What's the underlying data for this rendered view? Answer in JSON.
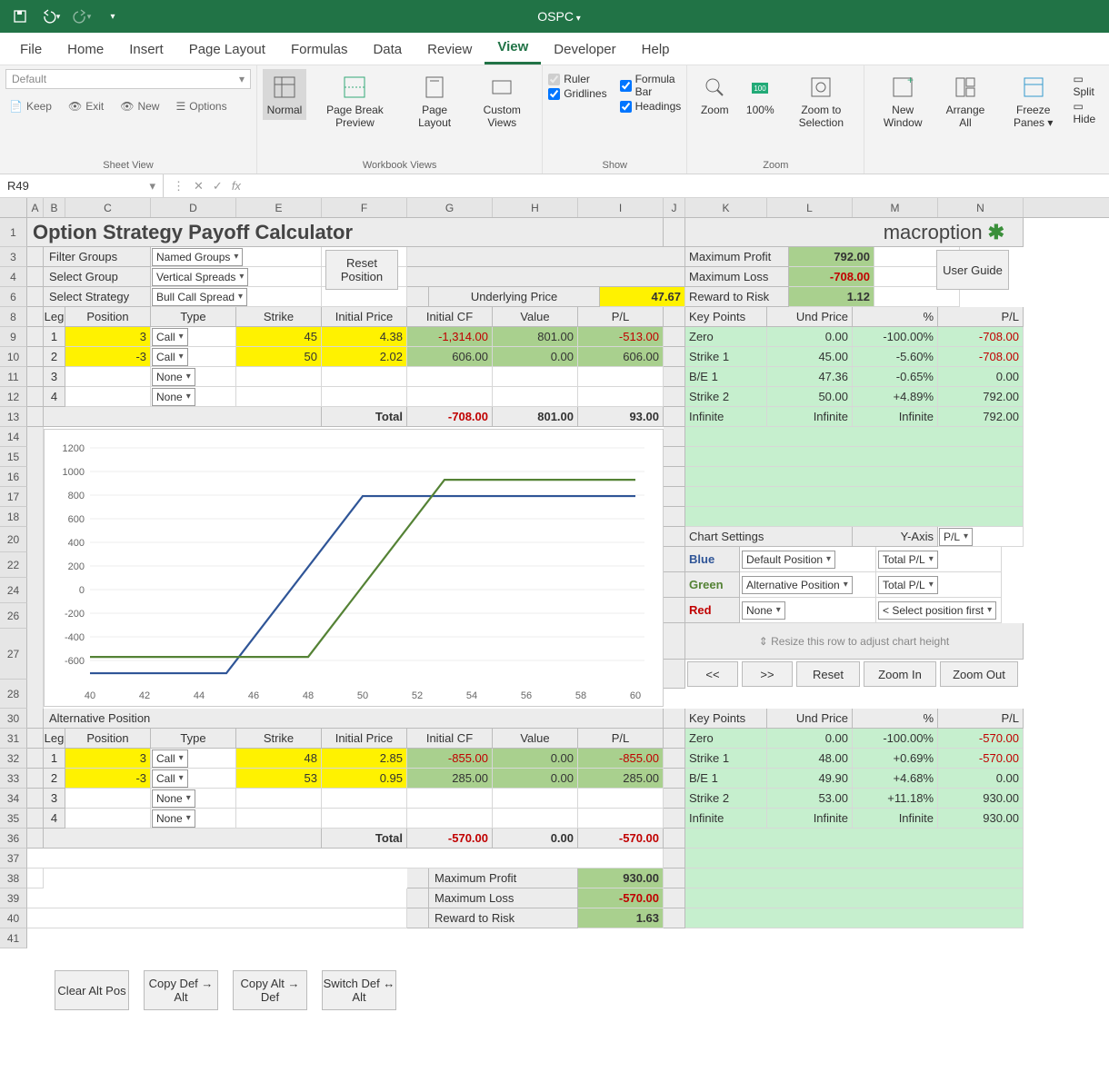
{
  "app": {
    "doc": "OSPC"
  },
  "tabs": [
    "File",
    "Home",
    "Insert",
    "Page Layout",
    "Formulas",
    "Data",
    "Review",
    "View",
    "Developer",
    "Help"
  ],
  "active_tab": "View",
  "ribbon": {
    "sheet_view": {
      "dropdown": "Default",
      "keep": "Keep",
      "exit": "Exit",
      "new": "New",
      "options": "Options",
      "label": "Sheet View"
    },
    "workbook_views": {
      "normal": "Normal",
      "pbp": "Page Break Preview",
      "layout": "Page Layout",
      "custom": "Custom Views",
      "label": "Workbook Views"
    },
    "show": {
      "ruler": "Ruler",
      "formula": "Formula Bar",
      "grid": "Gridlines",
      "headings": "Headings",
      "label": "Show"
    },
    "zoom": {
      "zoom": "Zoom",
      "p100": "100%",
      "sel": "Zoom to Selection",
      "label": "Zoom"
    },
    "window": {
      "neww": "New Window",
      "arrange": "Arrange All",
      "freeze": "Freeze Panes ▾",
      "split": "Split",
      "hide": "Hide"
    }
  },
  "namebox": "R49",
  "fx_label": "fx",
  "cols": [
    "A",
    "B",
    "C",
    "D",
    "E",
    "F",
    "G",
    "H",
    "I",
    "J",
    "K",
    "L",
    "M",
    "N"
  ],
  "rows_labels": [
    "1",
    "3",
    "4",
    "6",
    "8",
    "9",
    "10",
    "11",
    "12",
    "13",
    "14",
    "15",
    "16",
    "17",
    "18",
    "20",
    "22",
    "24",
    "26",
    "27",
    "28",
    "30",
    "31",
    "32",
    "33",
    "34",
    "35",
    "36",
    "37",
    "38",
    "39",
    "40",
    "41"
  ],
  "title": "Option Strategy Payoff Calculator",
  "logo_text": "macroption",
  "filters": {
    "filter_groups_l": "Filter Groups",
    "filter_groups_v": "Named Groups",
    "select_group_l": "Select Group",
    "select_group_v": "Vertical Spreads",
    "select_strategy_l": "Select Strategy",
    "select_strategy_v": "Bull Call Spread",
    "reset": "Reset Position",
    "user_guide": "User Guide"
  },
  "ul_price_l": "Underlying Price",
  "ul_price": "47.67",
  "max_profit_l": "Maximum Profit",
  "max_profit": "792.00",
  "max_loss_l": "Maximum Loss",
  "max_loss": "-708.00",
  "rtr_l": "Reward to Risk",
  "rtr": "1.12",
  "tbl_head": {
    "leg": "Leg",
    "pos": "Position",
    "type": "Type",
    "strike": "Strike",
    "price": "Initial Price",
    "cf": "Initial CF",
    "val": "Value",
    "pl": "P/L",
    "total": "Total"
  },
  "legs": [
    {
      "n": "1",
      "pos": "3",
      "type": "Call",
      "strike": "45",
      "price": "4.38",
      "cf": "-1,314.00",
      "val": "801.00",
      "pl": "-513.00"
    },
    {
      "n": "2",
      "pos": "-3",
      "type": "Call",
      "strike": "50",
      "price": "2.02",
      "cf": "606.00",
      "val": "0.00",
      "pl": "606.00"
    },
    {
      "n": "3",
      "pos": "",
      "type": "None",
      "strike": "",
      "price": "",
      "cf": "",
      "val": "",
      "pl": ""
    },
    {
      "n": "4",
      "pos": "",
      "type": "None",
      "strike": "",
      "price": "",
      "cf": "",
      "val": "",
      "pl": ""
    }
  ],
  "legs_total": {
    "cf": "-708.00",
    "val": "801.00",
    "pl": "93.00"
  },
  "kp_head": {
    "kp": "Key Points",
    "up": "Und Price",
    "pct": "%",
    "pl": "P/L"
  },
  "kp1": [
    {
      "k": "Zero",
      "up": "0.00",
      "pct": "-100.00%",
      "pl": "-708.00"
    },
    {
      "k": "Strike 1",
      "up": "45.00",
      "pct": "-5.60%",
      "pl": "-708.00"
    },
    {
      "k": "B/E 1",
      "up": "47.36",
      "pct": "-0.65%",
      "pl": "0.00"
    },
    {
      "k": "Strike 2",
      "up": "50.00",
      "pct": "+4.89%",
      "pl": "792.00"
    },
    {
      "k": "Infinite",
      "up": "Infinite",
      "pct": "Infinite",
      "pl": "792.00"
    }
  ],
  "chart_settings": {
    "label": "Chart Settings",
    "yaxis_l": "Y-Axis",
    "yaxis_v": "P/L",
    "blue": "Blue",
    "blue_a": "Default Position",
    "blue_b": "Total P/L",
    "green": "Green",
    "green_a": "Alternative Position",
    "green_b": "Total P/L",
    "red": "Red",
    "red_a": "None",
    "red_b": "< Select position first",
    "resize": "⇕ Resize this row to adjust chart height",
    "btns": {
      "back": "<<",
      "fwd": ">>",
      "reset": "Reset",
      "zin": "Zoom In",
      "zout": "Zoom Out"
    }
  },
  "altpos_label": "Alternative Position",
  "legs2": [
    {
      "n": "1",
      "pos": "3",
      "type": "Call",
      "strike": "48",
      "price": "2.85",
      "cf": "-855.00",
      "val": "0.00",
      "pl": "-855.00"
    },
    {
      "n": "2",
      "pos": "-3",
      "type": "Call",
      "strike": "53",
      "price": "0.95",
      "cf": "285.00",
      "val": "0.00",
      "pl": "285.00"
    },
    {
      "n": "3",
      "pos": "",
      "type": "None",
      "strike": "",
      "price": "",
      "cf": "",
      "val": "",
      "pl": ""
    },
    {
      "n": "4",
      "pos": "",
      "type": "None",
      "strike": "",
      "price": "",
      "cf": "",
      "val": "",
      "pl": ""
    }
  ],
  "legs2_total": {
    "cf": "-570.00",
    "val": "0.00",
    "pl": "-570.00"
  },
  "kp2": [
    {
      "k": "Zero",
      "up": "0.00",
      "pct": "-100.00%",
      "pl": "-570.00"
    },
    {
      "k": "Strike 1",
      "up": "48.00",
      "pct": "+0.69%",
      "pl": "-570.00"
    },
    {
      "k": "B/E 1",
      "up": "49.90",
      "pct": "+4.68%",
      "pl": "0.00"
    },
    {
      "k": "Strike 2",
      "up": "53.00",
      "pct": "+11.18%",
      "pl": "930.00"
    },
    {
      "k": "Infinite",
      "up": "Infinite",
      "pct": "Infinite",
      "pl": "930.00"
    }
  ],
  "alt_btns": {
    "clear": "Clear Alt Pos",
    "copy_da": "Copy Def → Alt",
    "copy_ad": "Copy Alt → Def",
    "switch": "Switch Def ↔ Alt"
  },
  "alt_summary": {
    "mp_l": "Maximum Profit",
    "mp": "930.00",
    "ml_l": "Maximum Loss",
    "ml": "-570.00",
    "rtr_l": "Reward to Risk",
    "rtr": "1.63"
  },
  "chart_data": {
    "type": "line",
    "x": [
      40,
      42,
      44,
      46,
      48,
      50,
      52,
      54,
      56,
      58,
      60
    ],
    "xlabel": "",
    "ylabel": "",
    "ylim": [
      -800,
      1200
    ],
    "y_ticks": [
      -600,
      -400,
      -200,
      0,
      200,
      400,
      600,
      800,
      1000,
      1200
    ],
    "series": [
      {
        "name": "Default Position",
        "color": "#2f5597",
        "points": [
          [
            40,
            -708
          ],
          [
            45,
            -708
          ],
          [
            50,
            792
          ],
          [
            60,
            792
          ]
        ]
      },
      {
        "name": "Alternative Position",
        "color": "#548235",
        "points": [
          [
            40,
            -570
          ],
          [
            48,
            -570
          ],
          [
            53,
            930
          ],
          [
            60,
            930
          ]
        ]
      }
    ]
  }
}
